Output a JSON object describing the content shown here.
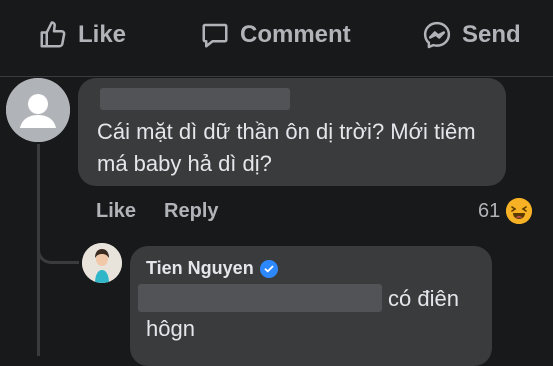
{
  "actions": {
    "like_label": "Like",
    "comment_label": "Comment",
    "send_label": "Send"
  },
  "comment": {
    "text": "Cái mặt dì dữ thần ôn dị trời? Mới tiêm má baby hả dì dị?",
    "like_label": "Like",
    "reply_label": "Reply",
    "reaction_count": "61",
    "reaction_icon": "haha-emoji-icon"
  },
  "reply": {
    "author": "Tien Nguyen",
    "verified_icon": "verified-badge-icon",
    "text_line1": "có điên",
    "text_line2": "hôgn"
  },
  "colors": {
    "background": "#18191a",
    "bubble": "#3a3b3c",
    "muted_text": "#b0b3b8",
    "verified": "#2d88ff",
    "haha": "#f7b125"
  }
}
